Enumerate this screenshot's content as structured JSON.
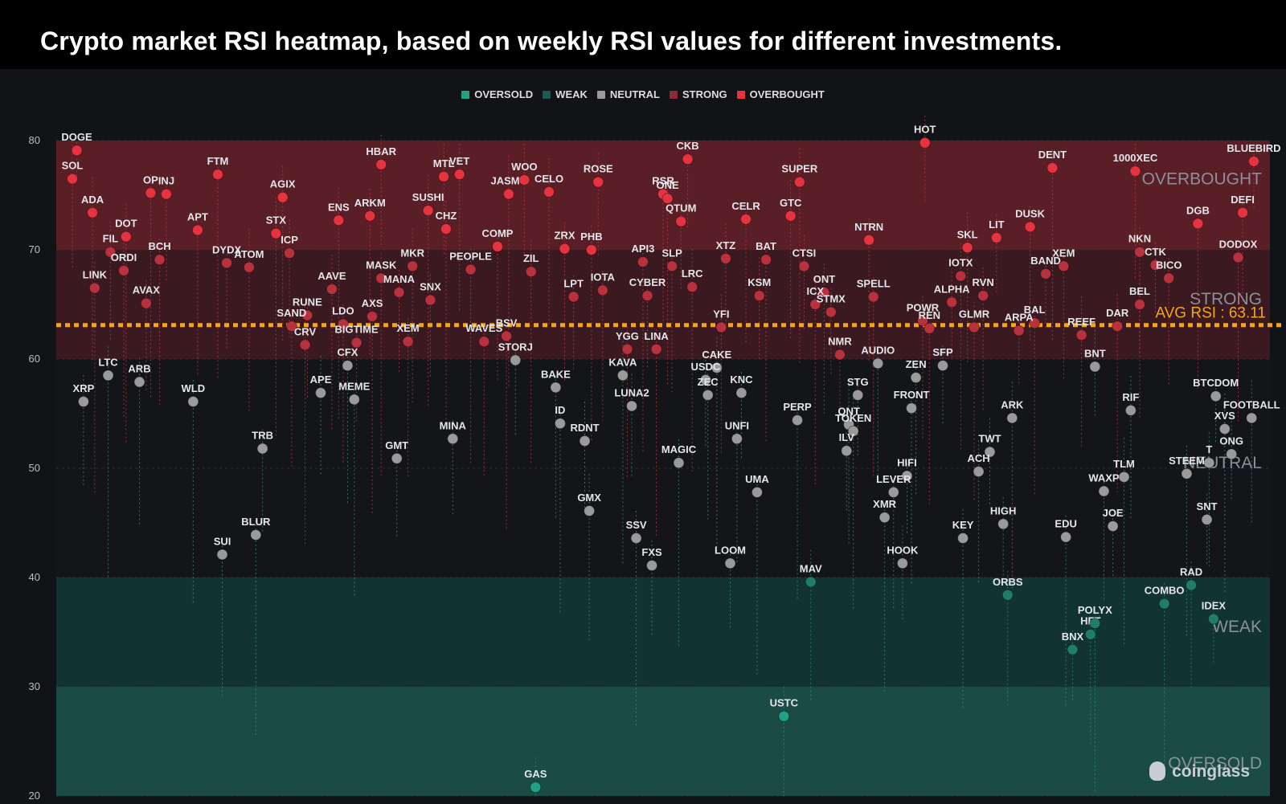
{
  "page": {
    "title": "Crypto market RSI heatmap, based on weekly RSI values for different investments.",
    "watermark": "coinglass"
  },
  "colors": {
    "background": "#121317",
    "oversold": "#1ea386",
    "weak": "#1a5a50",
    "neutral": "#9a9a9a",
    "strong": "#8a2a36",
    "overbought": "#e5333f",
    "avg_line": "#f3a51c"
  },
  "chart_data": {
    "type": "scatter",
    "title": "",
    "xlabel": "",
    "ylabel": "",
    "ylim": [
      20,
      80
    ],
    "yticks": [
      "20",
      "30",
      "40",
      "50",
      "60",
      "70",
      "80"
    ],
    "legend": {
      "placement": "top-center",
      "entries": [
        {
          "label": "OVERSOLD",
          "color": "#1ea386"
        },
        {
          "label": "WEAK",
          "color": "#1a5a50"
        },
        {
          "label": "NEUTRAL",
          "color": "#9a9a9a"
        },
        {
          "label": "STRONG",
          "color": "#8a2a36"
        },
        {
          "label": "OVERBOUGHT",
          "color": "#e5333f"
        }
      ]
    },
    "zones": [
      {
        "label": "OVERBOUGHT",
        "from": 70,
        "to": 80
      },
      {
        "label": "STRONG",
        "from": 60,
        "to": 70
      },
      {
        "label": "NEUTRAL",
        "from": 40,
        "to": 60
      },
      {
        "label": "WEAK",
        "from": 30,
        "to": 40
      },
      {
        "label": "OVERSOLD",
        "from": 20,
        "to": 30
      }
    ],
    "avg_rsi": {
      "label": "AVG RSI : 63.11",
      "value": 63.11
    },
    "points": [
      {
        "name": "DOGE",
        "x": 1,
        "y": 79.1
      },
      {
        "name": "SOL",
        "x": 0.8,
        "y": 76.5
      },
      {
        "name": "ADA",
        "x": 1.7,
        "y": 73.4
      },
      {
        "name": "DOT",
        "x": 3.2,
        "y": 71.2
      },
      {
        "name": "FIL",
        "x": 2.5,
        "y": 69.8
      },
      {
        "name": "ORDI",
        "x": 3.1,
        "y": 68.1
      },
      {
        "name": "LINK",
        "x": 1.8,
        "y": 66.5
      },
      {
        "name": "AVAX",
        "x": 4.1,
        "y": 65.1
      },
      {
        "name": "BCH",
        "x": 4.7,
        "y": 69.1
      },
      {
        "name": "OP",
        "x": 4.3,
        "y": 75.2
      },
      {
        "name": "INJ",
        "x": 5,
        "y": 75.1
      },
      {
        "name": "APT",
        "x": 6.4,
        "y": 71.8
      },
      {
        "name": "FTM",
        "x": 7.3,
        "y": 76.9
      },
      {
        "name": "DYDX",
        "x": 7.7,
        "y": 68.8
      },
      {
        "name": "ATOM",
        "x": 8.7,
        "y": 68.4
      },
      {
        "name": "STX",
        "x": 9.9,
        "y": 71.5
      },
      {
        "name": "ICP",
        "x": 10.5,
        "y": 69.7
      },
      {
        "name": "AGIX",
        "x": 10.2,
        "y": 74.8
      },
      {
        "name": "LTC",
        "x": 2.4,
        "y": 58.5
      },
      {
        "name": "XRP",
        "x": 1.3,
        "y": 56.1
      },
      {
        "name": "ARB",
        "x": 3.8,
        "y": 57.9
      },
      {
        "name": "WLD",
        "x": 6.2,
        "y": 56.1
      },
      {
        "name": "TRB",
        "x": 9.3,
        "y": 51.8
      },
      {
        "name": "SUI",
        "x": 7.5,
        "y": 42.1
      },
      {
        "name": "BLUR",
        "x": 9,
        "y": 43.9
      },
      {
        "name": "RUNE",
        "x": 11.3,
        "y": 64
      },
      {
        "name": "SAND",
        "x": 10.6,
        "y": 63
      },
      {
        "name": "CRV",
        "x": 11.2,
        "y": 61.3
      },
      {
        "name": "APE",
        "x": 11.9,
        "y": 56.9
      },
      {
        "name": "AAVE",
        "x": 12.4,
        "y": 66.4
      },
      {
        "name": "ENS",
        "x": 12.7,
        "y": 72.7
      },
      {
        "name": "HBAR",
        "x": 14.6,
        "y": 77.8
      },
      {
        "name": "ARKM",
        "x": 14.1,
        "y": 73.1
      },
      {
        "name": "MASK",
        "x": 14.6,
        "y": 67.4
      },
      {
        "name": "MANA",
        "x": 15.4,
        "y": 66.1
      },
      {
        "name": "LDO",
        "x": 12.9,
        "y": 63.2
      },
      {
        "name": "AXS",
        "x": 14.2,
        "y": 63.9
      },
      {
        "name": "BIGTIME",
        "x": 13.5,
        "y": 61.5
      },
      {
        "name": "CFX",
        "x": 13.1,
        "y": 59.4
      },
      {
        "name": "MEME",
        "x": 13.4,
        "y": 56.3
      },
      {
        "name": "GMT",
        "x": 15.3,
        "y": 50.9
      },
      {
        "name": "MKR",
        "x": 16,
        "y": 68.5
      },
      {
        "name": "SUSHI",
        "x": 16.7,
        "y": 73.6
      },
      {
        "name": "MTL",
        "x": 17.4,
        "y": 76.7
      },
      {
        "name": "VET",
        "x": 18.1,
        "y": 76.9
      },
      {
        "name": "CHZ",
        "x": 17.5,
        "y": 71.9
      },
      {
        "name": "SNX",
        "x": 16.8,
        "y": 65.4
      },
      {
        "name": "XEM",
        "x": 15.8,
        "y": 61.6
      },
      {
        "name": "PEOPLE",
        "x": 18.6,
        "y": 68.2
      },
      {
        "name": "MINA",
        "x": 17.8,
        "y": 52.7
      },
      {
        "name": "WAVES",
        "x": 19.2,
        "y": 61.6
      },
      {
        "name": "BSV",
        "x": 20.2,
        "y": 62.1
      },
      {
        "name": "STORJ",
        "x": 20.6,
        "y": 59.9
      },
      {
        "name": "COMP",
        "x": 19.8,
        "y": 70.3
      },
      {
        "name": "JASMY",
        "x": 20.3,
        "y": 75.1
      },
      {
        "name": "WOO",
        "x": 21,
        "y": 76.4
      },
      {
        "name": "CELO",
        "x": 22.1,
        "y": 75.3
      },
      {
        "name": "ZIL",
        "x": 21.3,
        "y": 68
      },
      {
        "name": "ROSE",
        "x": 24.3,
        "y": 76.2
      },
      {
        "name": "ZRX",
        "x": 22.8,
        "y": 70.1
      },
      {
        "name": "PHB",
        "x": 24,
        "y": 70
      },
      {
        "name": "LPT",
        "x": 23.2,
        "y": 65.7
      },
      {
        "name": "IOTA",
        "x": 24.5,
        "y": 66.3
      },
      {
        "name": "API3",
        "x": 26.3,
        "y": 68.9
      },
      {
        "name": "CYBER",
        "x": 26.5,
        "y": 65.8
      },
      {
        "name": "BAKE",
        "x": 22.4,
        "y": 57.4
      },
      {
        "name": "ID",
        "x": 22.6,
        "y": 54.1
      },
      {
        "name": "RDNT",
        "x": 23.7,
        "y": 52.5
      },
      {
        "name": "GMX",
        "x": 23.9,
        "y": 46.1
      },
      {
        "name": "KAVA",
        "x": 25.4,
        "y": 58.5
      },
      {
        "name": "LUNA2",
        "x": 25.8,
        "y": 55.7
      },
      {
        "name": "GAS",
        "x": 21.5,
        "y": 20.8
      },
      {
        "name": "SSV",
        "x": 26,
        "y": 43.6
      },
      {
        "name": "FXS",
        "x": 26.7,
        "y": 41.1
      },
      {
        "name": "YGG",
        "x": 25.6,
        "y": 60.9
      },
      {
        "name": "LINA",
        "x": 26.9,
        "y": 60.9
      },
      {
        "name": "CKB",
        "x": 28.3,
        "y": 78.3
      },
      {
        "name": "RSR",
        "x": 27.2,
        "y": 75.1
      },
      {
        "name": "ONE",
        "x": 27.4,
        "y": 74.7
      },
      {
        "name": "QTUM",
        "x": 28,
        "y": 72.6
      },
      {
        "name": "SLP",
        "x": 27.6,
        "y": 68.5
      },
      {
        "name": "LRC",
        "x": 28.5,
        "y": 66.6
      },
      {
        "name": "XTZ",
        "x": 30,
        "y": 69.2
      },
      {
        "name": "YFI",
        "x": 29.8,
        "y": 62.9
      },
      {
        "name": "CAKE",
        "x": 29.6,
        "y": 59.2
      },
      {
        "name": "USDC",
        "x": 29.1,
        "y": 58.1
      },
      {
        "name": "ZEC",
        "x": 29.2,
        "y": 56.7
      },
      {
        "name": "MAGIC",
        "x": 27.9,
        "y": 50.5
      },
      {
        "name": "KNC",
        "x": 30.7,
        "y": 56.9
      },
      {
        "name": "UNFI",
        "x": 30.5,
        "y": 52.7
      },
      {
        "name": "UMA",
        "x": 31.4,
        "y": 47.8
      },
      {
        "name": "LOOM",
        "x": 30.2,
        "y": 41.3
      },
      {
        "name": "CELR",
        "x": 30.9,
        "y": 72.8
      },
      {
        "name": "BAT",
        "x": 31.8,
        "y": 69.1
      },
      {
        "name": "KSM",
        "x": 31.5,
        "y": 65.8
      },
      {
        "name": "GTC",
        "x": 32.9,
        "y": 73.1
      },
      {
        "name": "SUPER",
        "x": 33.3,
        "y": 76.2
      },
      {
        "name": "CTSI",
        "x": 33.5,
        "y": 68.5
      },
      {
        "name": "ONT",
        "x": 34.4,
        "y": 66.1
      },
      {
        "name": "ICX",
        "x": 34,
        "y": 65
      },
      {
        "name": "STMX",
        "x": 34.7,
        "y": 64.3
      },
      {
        "name": "NTRN",
        "x": 36.4,
        "y": 70.9
      },
      {
        "name": "SPELL",
        "x": 36.6,
        "y": 65.7
      },
      {
        "name": "NMR",
        "x": 35.1,
        "y": 60.4
      },
      {
        "name": "AUDIO",
        "x": 36.8,
        "y": 59.6
      },
      {
        "name": "PERP",
        "x": 33.2,
        "y": 54.4
      },
      {
        "name": "STG",
        "x": 35.9,
        "y": 56.7
      },
      {
        "name": "QNT",
        "x": 35.5,
        "y": 54
      },
      {
        "name": "TOKEN",
        "x": 35.7,
        "y": 53.4
      },
      {
        "name": "ILV",
        "x": 35.4,
        "y": 51.6
      },
      {
        "name": "MAV",
        "x": 33.8,
        "y": 39.6
      },
      {
        "name": "USTC",
        "x": 32.6,
        "y": 27.3
      },
      {
        "name": "HOT",
        "x": 38.9,
        "y": 79.8
      },
      {
        "name": "POWR",
        "x": 38.8,
        "y": 63.5
      },
      {
        "name": "REN",
        "x": 39.1,
        "y": 62.8
      },
      {
        "name": "SFP",
        "x": 39.7,
        "y": 59.4
      },
      {
        "name": "ZEN",
        "x": 38.5,
        "y": 58.3
      },
      {
        "name": "FRONT",
        "x": 38.3,
        "y": 55.5
      },
      {
        "name": "HIFI",
        "x": 38.1,
        "y": 49.3
      },
      {
        "name": "LEVER",
        "x": 37.5,
        "y": 47.8
      },
      {
        "name": "XMR",
        "x": 37.1,
        "y": 45.5
      },
      {
        "name": "HOOK",
        "x": 37.9,
        "y": 41.3
      },
      {
        "name": "SKL",
        "x": 40.8,
        "y": 70.2
      },
      {
        "name": "IOTX",
        "x": 40.5,
        "y": 67.6
      },
      {
        "name": "ALPHA",
        "x": 40.1,
        "y": 65.2
      },
      {
        "name": "RVN",
        "x": 41.5,
        "y": 65.8
      },
      {
        "name": "GLMR",
        "x": 41.1,
        "y": 62.9
      },
      {
        "name": "LIT",
        "x": 42.1,
        "y": 71.1
      },
      {
        "name": "DUSK",
        "x": 43.6,
        "y": 72.1
      },
      {
        "name": "DENT",
        "x": 44.6,
        "y": 77.5
      },
      {
        "name": "BAND",
        "x": 44.3,
        "y": 67.8
      },
      {
        "name": "XEM2",
        "x": 45.1,
        "y": 68.5
      },
      {
        "name": "BAL",
        "x": 43.8,
        "y": 63.3
      },
      {
        "name": "ARPA",
        "x": 43.1,
        "y": 62.6
      },
      {
        "name": "REEF",
        "x": 45.9,
        "y": 62.2
      },
      {
        "name": "ARK",
        "x": 42.8,
        "y": 54.6
      },
      {
        "name": "TWT",
        "x": 41.8,
        "y": 51.5
      },
      {
        "name": "ACH",
        "x": 41.3,
        "y": 49.7
      },
      {
        "name": "KEY",
        "x": 40.6,
        "y": 43.6
      },
      {
        "name": "HIGH",
        "x": 42.4,
        "y": 44.9
      },
      {
        "name": "ORBS",
        "x": 42.6,
        "y": 38.4
      },
      {
        "name": "EDU",
        "x": 45.2,
        "y": 43.7
      },
      {
        "name": "BNX",
        "x": 45.5,
        "y": 33.4
      },
      {
        "name": "HFT",
        "x": 46.3,
        "y": 34.8
      },
      {
        "name": "POLYX",
        "x": 46.5,
        "y": 35.8
      },
      {
        "name": "JOE",
        "x": 47.3,
        "y": 44.7
      },
      {
        "name": "WAXP",
        "x": 46.9,
        "y": 47.9
      },
      {
        "name": "TLM",
        "x": 47.8,
        "y": 49.2
      },
      {
        "name": "BNT",
        "x": 46.5,
        "y": 59.3
      },
      {
        "name": "RIF",
        "x": 48.1,
        "y": 55.3
      },
      {
        "name": "DAR",
        "x": 47.5,
        "y": 63
      },
      {
        "name": "BEL",
        "x": 48.5,
        "y": 65
      },
      {
        "name": "1000XEC",
        "x": 48.3,
        "y": 77.2
      },
      {
        "name": "NKN",
        "x": 48.5,
        "y": 69.8
      },
      {
        "name": "CTK",
        "x": 49.2,
        "y": 68.6
      },
      {
        "name": "BICO",
        "x": 49.8,
        "y": 67.4
      },
      {
        "name": "DGB",
        "x": 51.1,
        "y": 72.4
      },
      {
        "name": "BLUEBIRD",
        "x": 53.6,
        "y": 78.1
      },
      {
        "name": "DEFI",
        "x": 53.1,
        "y": 73.4
      },
      {
        "name": "DODOX",
        "x": 52.9,
        "y": 69.3
      },
      {
        "name": "BTCDOM",
        "x": 51.9,
        "y": 56.6
      },
      {
        "name": "FOOTBALL",
        "x": 53.5,
        "y": 54.6
      },
      {
        "name": "XVS",
        "x": 52.3,
        "y": 53.6
      },
      {
        "name": "ONG",
        "x": 52.6,
        "y": 51.3
      },
      {
        "name": "T",
        "x": 51.6,
        "y": 50.5
      },
      {
        "name": "STEEM",
        "x": 50.6,
        "y": 49.5
      },
      {
        "name": "SNT",
        "x": 51.5,
        "y": 45.3
      },
      {
        "name": "RAD",
        "x": 50.8,
        "y": 39.3
      },
      {
        "name": "COMBO",
        "x": 49.6,
        "y": 37.6
      },
      {
        "name": "IDEX",
        "x": 51.8,
        "y": 36.2
      }
    ]
  }
}
